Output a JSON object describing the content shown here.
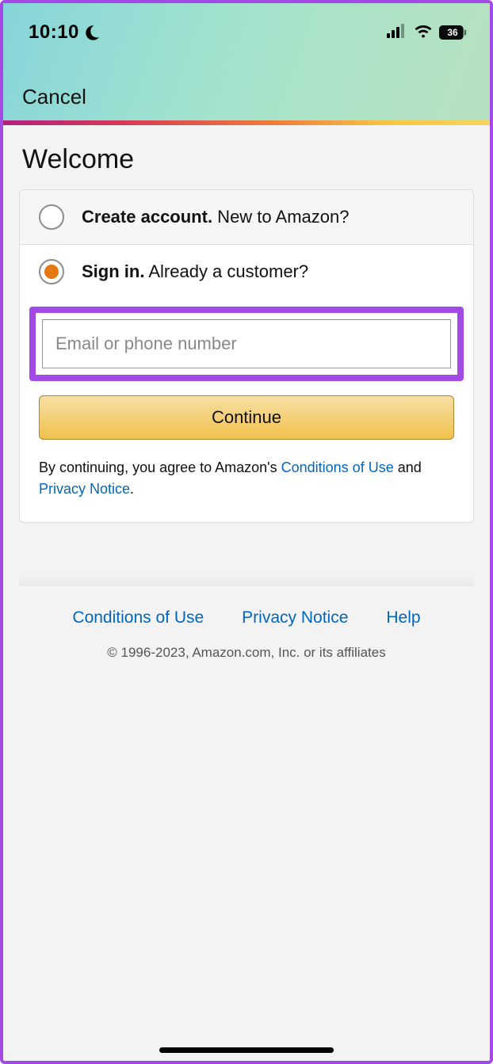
{
  "status_bar": {
    "time": "10:10",
    "battery_percent": "36"
  },
  "nav": {
    "cancel_label": "Cancel"
  },
  "page": {
    "title": "Welcome"
  },
  "options": {
    "create": {
      "bold": "Create account.",
      "rest": " New to Amazon?"
    },
    "signin": {
      "bold": "Sign in.",
      "rest": " Already a customer?"
    }
  },
  "form": {
    "email_placeholder": "Email or phone number",
    "email_value": "",
    "continue_label": "Continue"
  },
  "legal": {
    "prefix": "By continuing, you agree to Amazon's ",
    "conditions": "Conditions of Use",
    "and": " and ",
    "privacy": "Privacy Notice",
    "period": "."
  },
  "footer": {
    "links": {
      "conditions": "Conditions of Use",
      "privacy": "Privacy Notice",
      "help": "Help"
    },
    "copyright": "© 1996-2023, Amazon.com, Inc. or its affiliates"
  }
}
